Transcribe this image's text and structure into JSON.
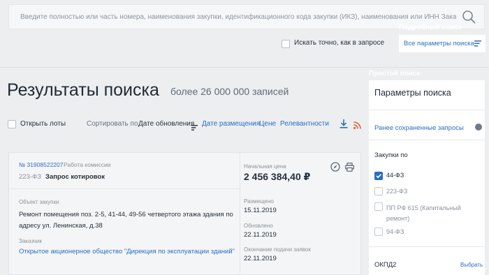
{
  "search": {
    "placeholder": "Введите полностью или часть номера, наименования закупки, идентификационного кода закупки (ИКЗ), наименования или ИНН Заказчика",
    "exact_label": "Искать точно, как в запросе",
    "all_params_label": "Все параметры поиска"
  },
  "tooltips": {
    "advanced": "Подробный поиск",
    "simple": "Простой поиск"
  },
  "results": {
    "title": "Результаты поиска",
    "count": "более 26 000 000 записей"
  },
  "toolbar": {
    "open_lots": "Открыть лоты",
    "sort_label": "Сортировать по",
    "sort_active": "Дате обновления",
    "sort_options": [
      "Дате размещения",
      "Цене",
      "Релевантности"
    ]
  },
  "card": {
    "reg_number": "№ 31908522207",
    "stage": "Работа комиссии",
    "law": "223-ФЗ",
    "method": "Запрос котировок",
    "object_caption": "Объект закупки",
    "object_text": "Ремонт помещения поз. 2-5, 41-44, 49-56 четвертого этажа здания по адресу ул. Ленинская, д.38",
    "customer_caption": "Заказчик",
    "customer_name": "Открытое акционерное общество \"Дирекция по эксплуатации зданий\"",
    "price_caption": "Начальная цена",
    "price_value": "2 456 384,40 ₽",
    "placed_caption": "Размещено",
    "placed_value": "15.11.2019",
    "updated_caption": "Обновлено",
    "updated_value": "22.11.2019",
    "deadline_caption": "Окончание подачи заявок",
    "deadline_value": "22.11.2019"
  },
  "panel": {
    "title": "Параметры поиска",
    "saved_link": "Ранее сохраненные запросы",
    "purchases_by": "Закупки по",
    "laws": [
      {
        "label": "44-ФЗ",
        "checked": true
      },
      {
        "label": "223-ФЗ",
        "checked": false
      },
      {
        "label": "ПП РФ 615 (Капитальный ремонт)",
        "checked": false
      },
      {
        "label": "94-ФЗ",
        "checked": false
      }
    ],
    "okpd_label": "ОКПД2",
    "okpd_select": "Выбрать"
  },
  "colors": {
    "accent": "#2a6dc2",
    "rss": "#e05a2b",
    "background": "#eceef0"
  }
}
